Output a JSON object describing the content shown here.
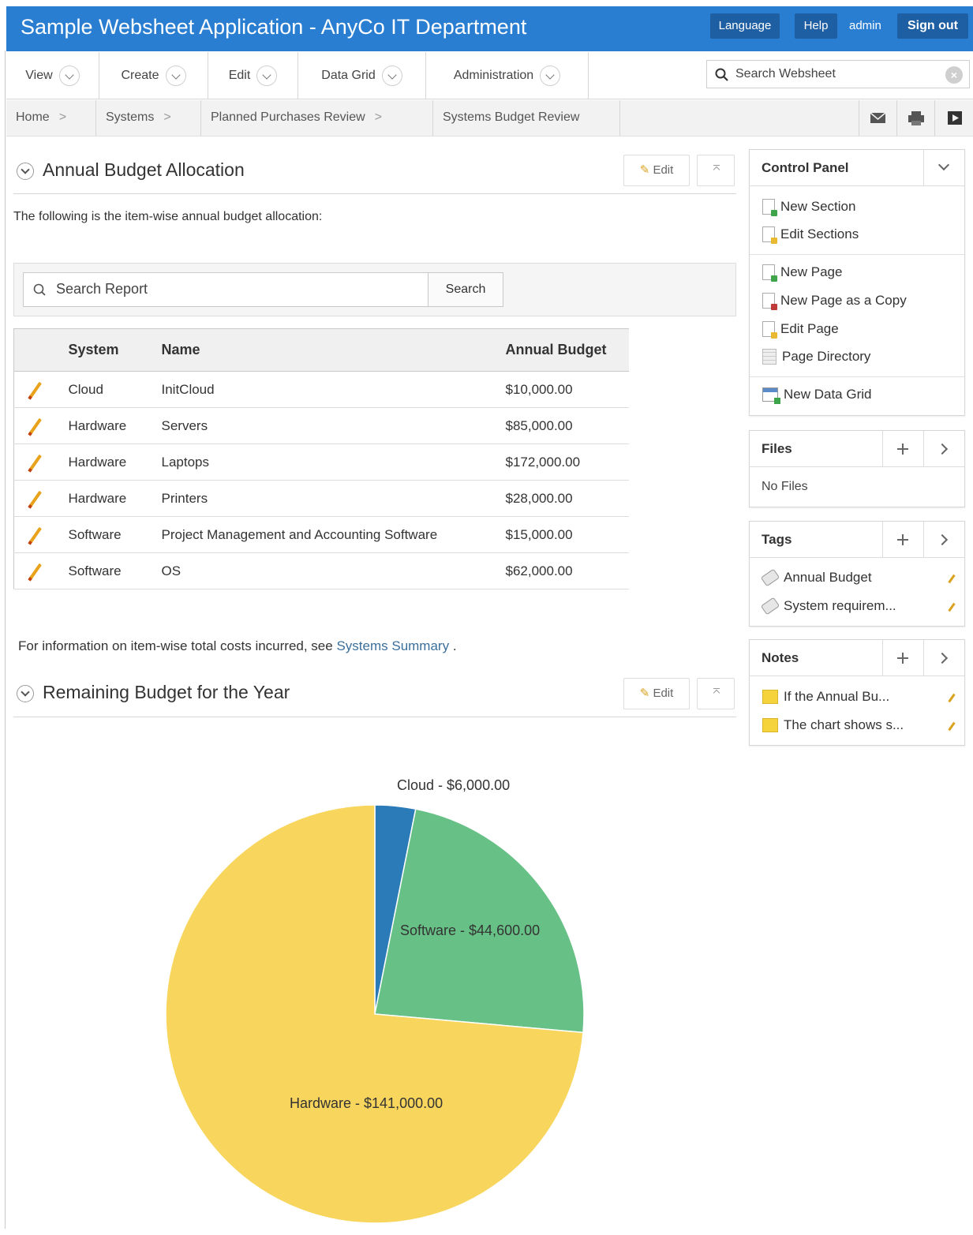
{
  "header": {
    "title": "Sample Websheet Application - AnyCo IT Department",
    "language": "Language",
    "help": "Help",
    "user": "admin",
    "signout": "Sign out"
  },
  "menu": {
    "items": [
      "View",
      "Create",
      "Edit",
      "Data Grid",
      "Administration"
    ],
    "search_placeholder": "Search Websheet"
  },
  "breadcrumb": [
    "Home",
    "Systems",
    "Planned Purchases Review",
    "Systems Budget Review"
  ],
  "section1": {
    "title": "Annual Budget Allocation",
    "edit": "Edit",
    "intro": "The following is the item-wise annual budget allocation:"
  },
  "report": {
    "search_placeholder": "Search Report",
    "search_button": "Search",
    "columns": [
      "System",
      "Name",
      "Annual Budget"
    ],
    "rows": [
      [
        "Cloud",
        "InitCloud",
        "$10,000.00"
      ],
      [
        "Hardware",
        "Servers",
        "$85,000.00"
      ],
      [
        "Hardware",
        "Laptops",
        "$172,000.00"
      ],
      [
        "Hardware",
        "Printers",
        "$28,000.00"
      ],
      [
        "Software",
        "Project Management and Accounting Software",
        "$15,000.00"
      ],
      [
        "Software",
        "OS",
        "$62,000.00"
      ]
    ]
  },
  "info": {
    "text": "For information on item-wise total costs incurred, see",
    "link": "Systems Summary",
    "end": "."
  },
  "section2": {
    "title": "Remaining Budget for the Year",
    "edit": "Edit"
  },
  "sidebar": {
    "control_panel": {
      "title": "Control Panel",
      "items": [
        "New Section",
        "Edit Sections",
        "New Page",
        "New Page as a Copy",
        "Edit Page",
        "Page Directory",
        "New Data Grid"
      ]
    },
    "files": {
      "title": "Files",
      "empty": "No Files"
    },
    "tags": {
      "title": "Tags",
      "items": [
        "Annual Budget",
        "System requirem..."
      ]
    },
    "notes": {
      "title": "Notes",
      "items": [
        "If the Annual Bu...",
        "The chart shows s..."
      ]
    }
  },
  "chart_data": {
    "type": "pie",
    "slices": [
      {
        "label": "Cloud - $6,000.00",
        "category": "Cloud",
        "value": 6000,
        "color": "#2b7bb9"
      },
      {
        "label": "Software - $44,600.00",
        "category": "Software",
        "value": 44600,
        "color": "#67c186"
      },
      {
        "label": "Hardware - $141,000.00",
        "category": "Hardware",
        "value": 141000,
        "color": "#f8d55c"
      }
    ]
  }
}
